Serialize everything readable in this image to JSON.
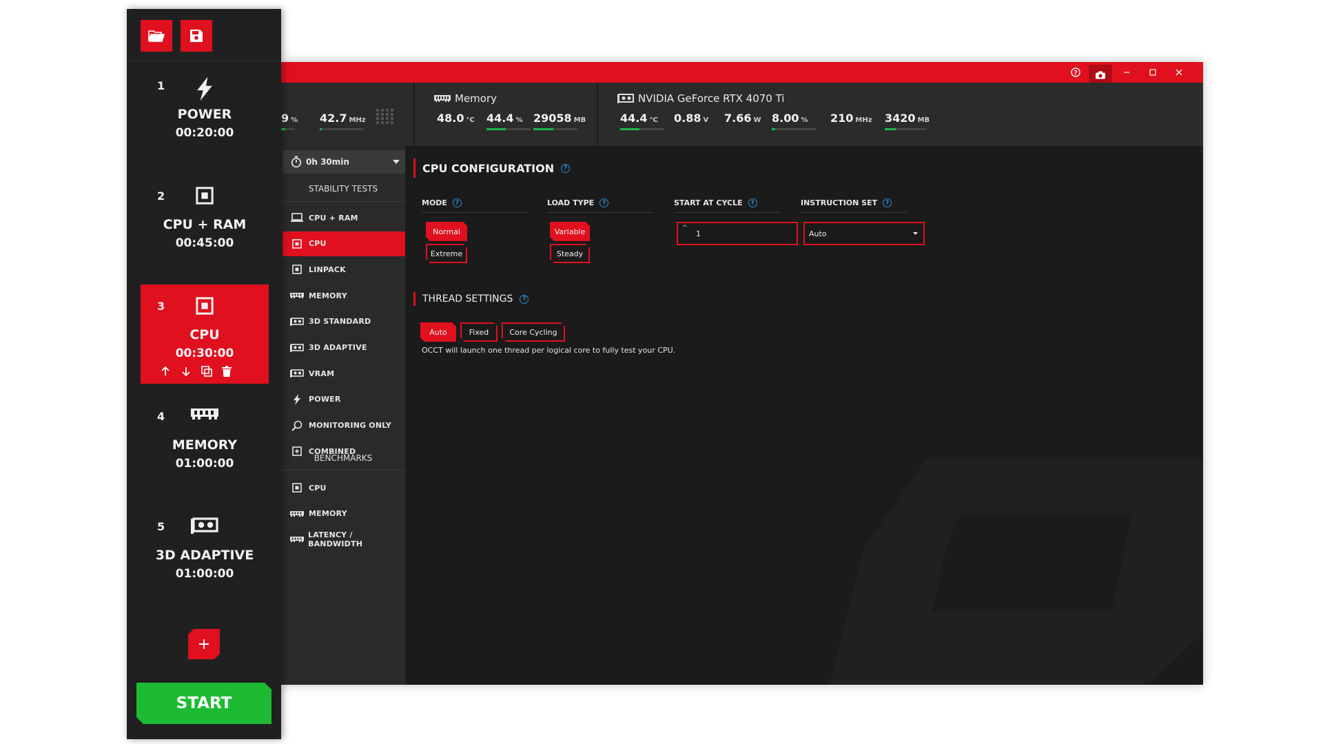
{
  "window": {
    "controls": [
      "help-icon",
      "camera-icon",
      "minimize-icon",
      "maximize-icon",
      "close-icon"
    ]
  },
  "stats": {
    "cpu_partial": [
      {
        "value": "9",
        "unit": "%",
        "fill": 0.3
      },
      {
        "value": "42.7",
        "unit": "MHz",
        "fill": 0.05
      }
    ],
    "memory": {
      "title": "Memory",
      "items": [
        {
          "value": "48.0",
          "unit": "°C",
          "fill": 0
        },
        {
          "value": "44.4",
          "unit": "%",
          "fill": 0.44
        },
        {
          "value": "29058",
          "unit": "MB",
          "fill": 0.45
        }
      ]
    },
    "gpu": {
      "title": "NVIDIA GeForce RTX 4070 Ti",
      "items": [
        {
          "value": "44.4",
          "unit": "°C",
          "fill": 0.44
        },
        {
          "value": "0.88",
          "unit": "V",
          "fill": 0
        },
        {
          "value": "7.66",
          "unit": "W",
          "fill": 0
        },
        {
          "value": "8.00",
          "unit": "%",
          "fill": 0.08
        },
        {
          "value": "210",
          "unit": "MHz",
          "fill": 0
        },
        {
          "value": "3420",
          "unit": "MB",
          "fill": 0.27
        }
      ]
    }
  },
  "nav": {
    "duration": "0h 30min",
    "stability_header": "STABILITY TESTS",
    "stability": [
      {
        "label": "CPU + RAM",
        "icon": "monitor-icon"
      },
      {
        "label": "CPU",
        "icon": "cpu-icon",
        "active": true
      },
      {
        "label": "LINPACK",
        "icon": "cpu-icon"
      },
      {
        "label": "MEMORY",
        "icon": "memory-icon"
      },
      {
        "label": "3D STANDARD",
        "icon": "gpu-icon"
      },
      {
        "label": "3D ADAPTIVE",
        "icon": "gpu-icon"
      },
      {
        "label": "VRAM",
        "icon": "gpu-icon"
      },
      {
        "label": "POWER",
        "icon": "bolt-icon"
      },
      {
        "label": "MONITORING ONLY",
        "icon": "magnifier-icon"
      },
      {
        "label": "COMBINED",
        "icon": "combined-icon"
      }
    ],
    "benchmarks_header": "BENCHMARKS",
    "benchmarks": [
      {
        "label": "CPU",
        "icon": "cpu-icon"
      },
      {
        "label": "MEMORY",
        "icon": "memory-icon"
      },
      {
        "label": "LATENCY / BANDWIDTH",
        "icon": "memory-icon"
      }
    ]
  },
  "config": {
    "title": "CPU CONFIGURATION",
    "mode": {
      "label": "MODE",
      "options": [
        "Normal",
        "Extreme"
      ],
      "selected": "Normal"
    },
    "load_type": {
      "label": "LOAD TYPE",
      "options": [
        "Variable",
        "Steady"
      ],
      "selected": "Variable"
    },
    "start_at_cycle": {
      "label": "START AT CYCLE",
      "value": "1"
    },
    "instruction_set": {
      "label": "INSTRUCTION SET",
      "value": "Auto"
    },
    "threads": {
      "title": "THREAD SETTINGS",
      "options": [
        "Auto",
        "Fixed",
        "Core Cycling"
      ],
      "selected": "Auto",
      "description": "OCCT will launch one thread per logical core to fully test your CPU."
    }
  },
  "sidebar": {
    "top_buttons": [
      "folder-open-icon",
      "save-icon"
    ],
    "steps": [
      {
        "num": "1",
        "name": "POWER",
        "time": "00:20:00",
        "icon": "bolt-icon"
      },
      {
        "num": "2",
        "name": "CPU + RAM",
        "time": "00:45:00",
        "icon": "cpu-icon"
      },
      {
        "num": "3",
        "name": "CPU",
        "time": "00:30:00",
        "icon": "cpu-icon",
        "active": true
      },
      {
        "num": "4",
        "name": "MEMORY",
        "time": "01:00:00",
        "icon": "memory-icon"
      },
      {
        "num": "5",
        "name": "3D ADAPTIVE",
        "time": "01:00:00",
        "icon": "gpu-icon"
      }
    ],
    "start_label": "START"
  },
  "colors": {
    "accent": "#e0101e",
    "start": "#1dbb32",
    "panel": "#1b1b1b",
    "nav": "#2a2a2b",
    "bar": "#20b84a",
    "help": "#2a8ed6"
  }
}
